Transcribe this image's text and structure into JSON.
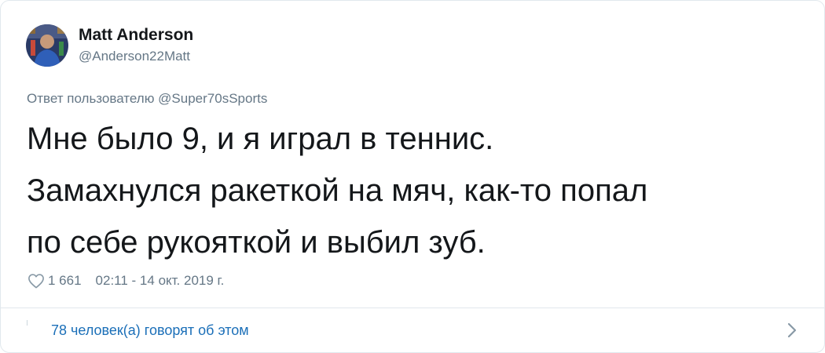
{
  "author": {
    "display_name": "Matt Anderson",
    "handle": "@Anderson22Matt",
    "avatar_icon": "profile-photo"
  },
  "reply_to": "Ответ пользователю @Super70sSports",
  "tweet": {
    "text": "Мне было 9, и я играл в теннис.\nЗамахнулся ракеткой на мяч, как-то попал\nпо себе рукояткой и выбил зуб."
  },
  "meta": {
    "like_icon": "heart-outline",
    "like_count": "1 661",
    "timestamp": "02:11 - 14 окт. 2019 г."
  },
  "footer": {
    "conversation_label": "78 человек(а) говорят об этом",
    "chevron_icon": "chevron-right"
  },
  "colors": {
    "text_primary": "#14171a",
    "text_secondary": "#657786",
    "link": "#1b6fb8",
    "border": "#e1e8ed"
  }
}
